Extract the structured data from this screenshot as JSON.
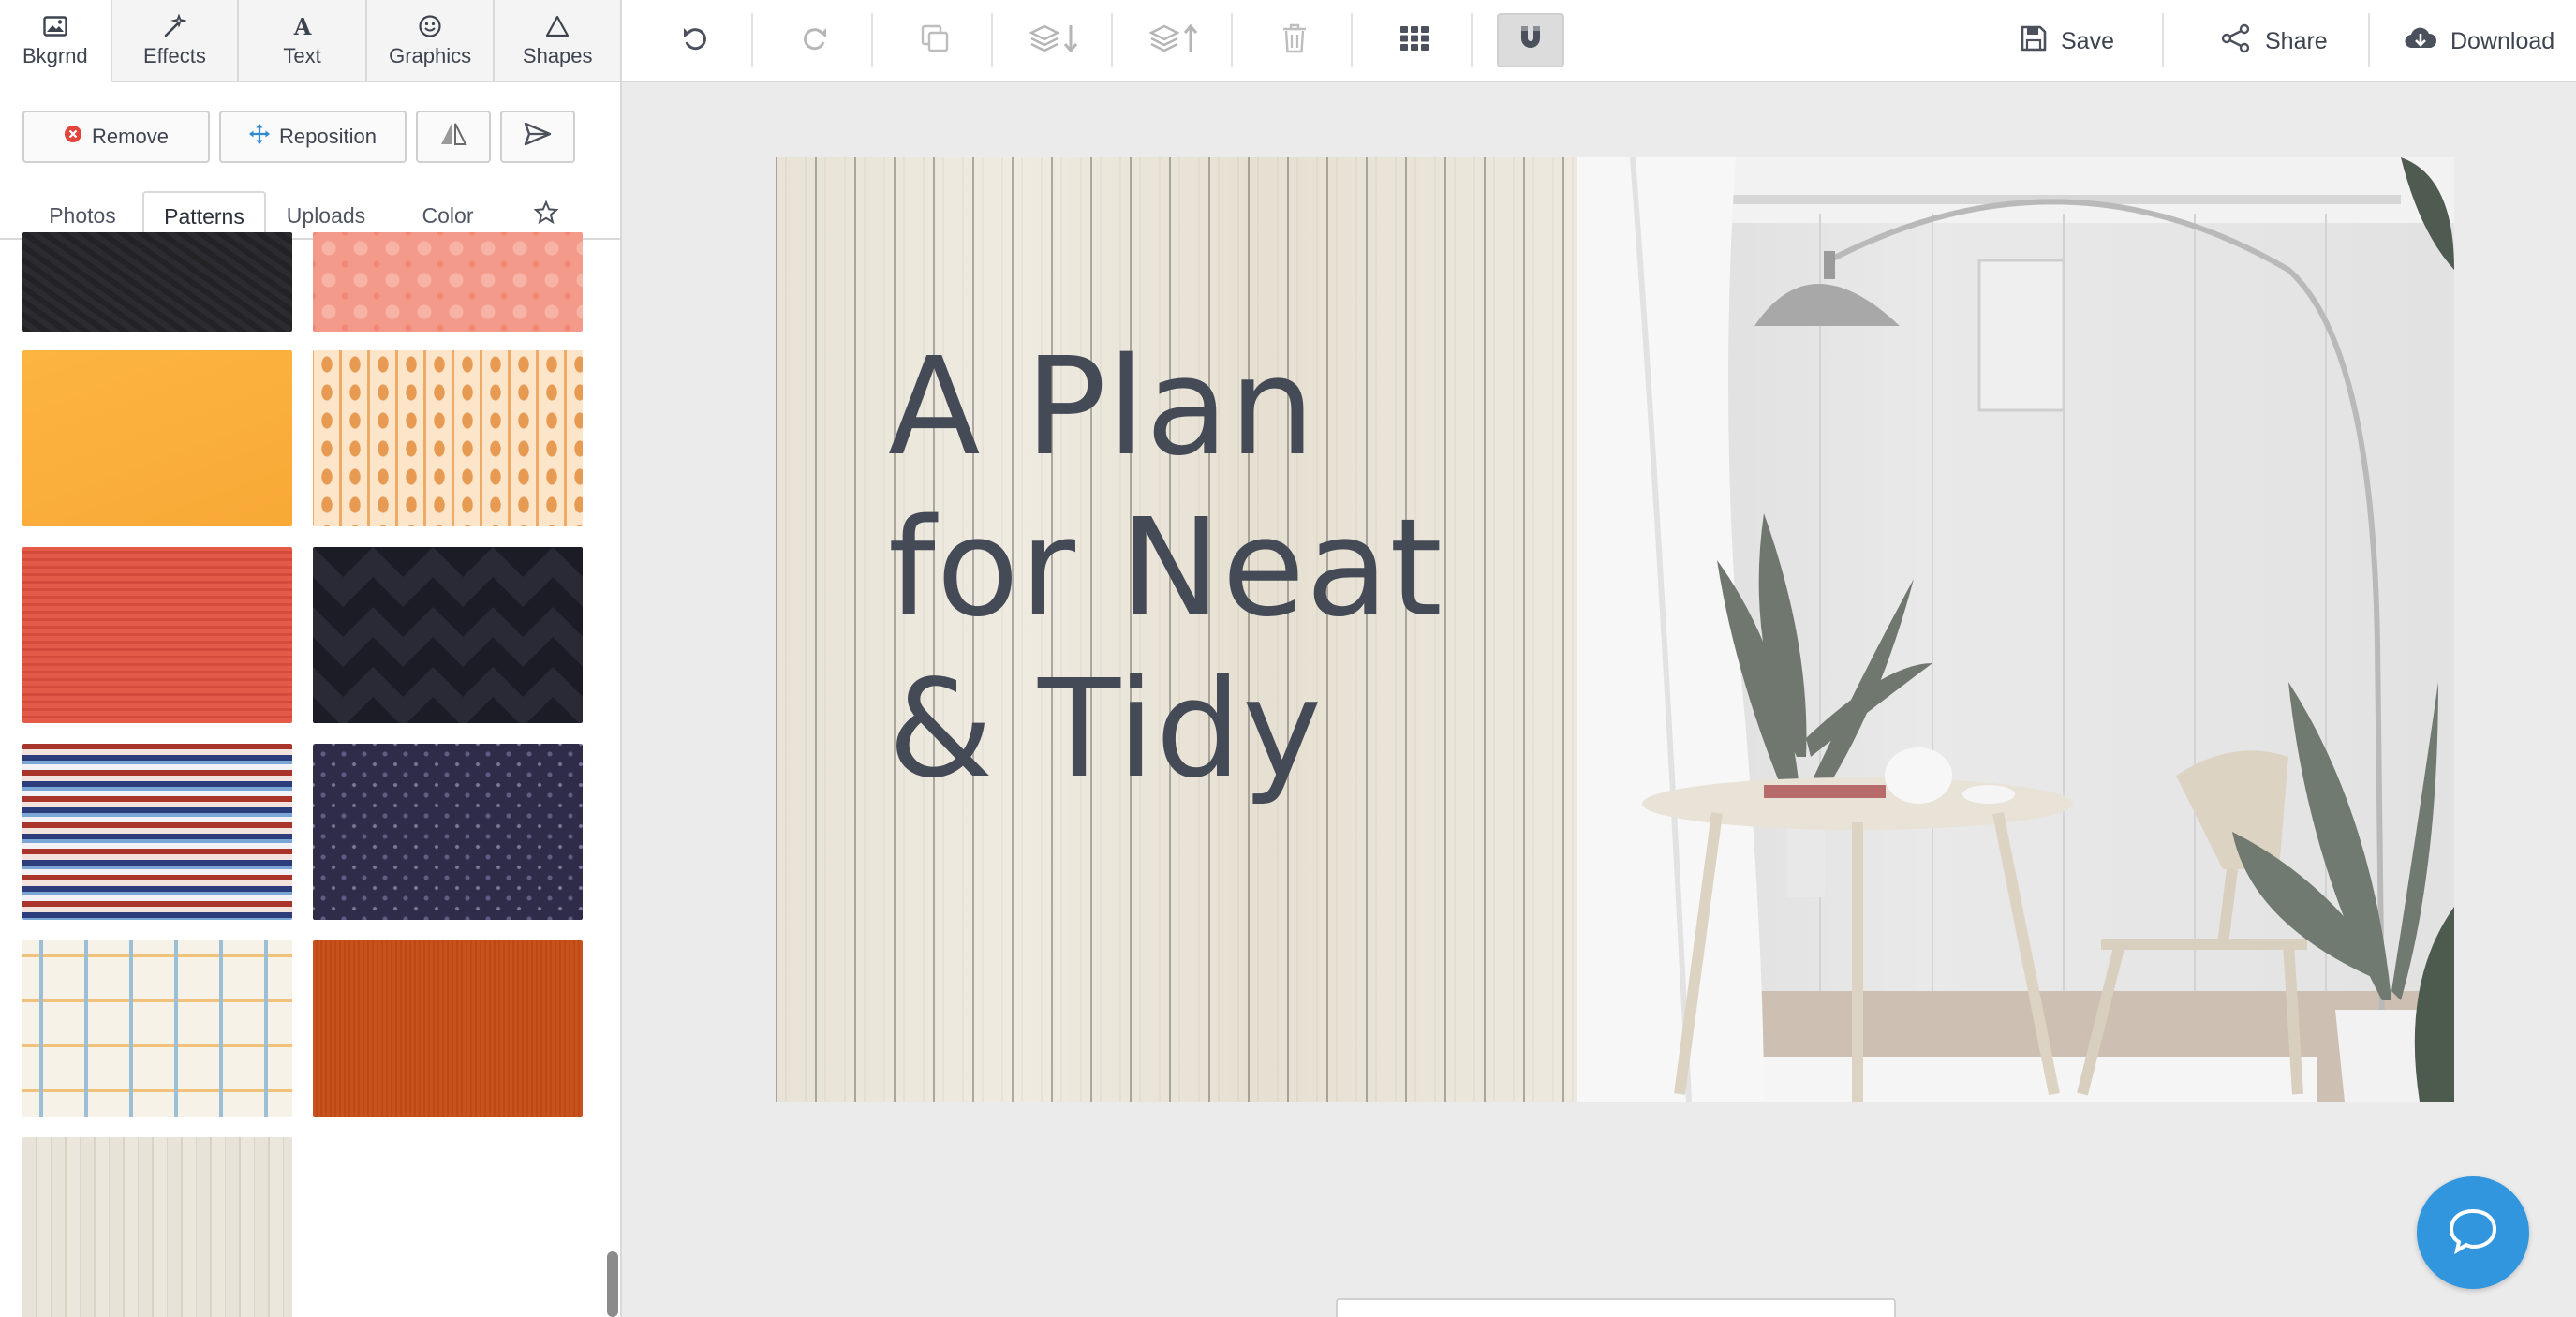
{
  "tool_tabs": [
    {
      "label": "Bkgrnd",
      "icon": "image-icon"
    },
    {
      "label": "Effects",
      "icon": "magic-wand-icon"
    },
    {
      "label": "Text",
      "icon": "text-icon"
    },
    {
      "label": "Graphics",
      "icon": "smiley-icon"
    },
    {
      "label": "Shapes",
      "icon": "triangle-icon"
    }
  ],
  "toolbar": {
    "icons": [
      "undo-icon",
      "redo-icon",
      "duplicate-icon",
      "send-backward-icon",
      "bring-forward-icon",
      "trash-icon",
      "grid-icon",
      "magnet-icon"
    ],
    "save_label": "Save",
    "share_label": "Share",
    "download_label": "Download"
  },
  "panel": {
    "remove_label": "Remove",
    "reposition_label": "Reposition",
    "subtabs": {
      "photos": "Photos",
      "patterns": "Patterns",
      "uploads": "Uploads",
      "color": "Color"
    },
    "active_subtab": "Patterns"
  },
  "patterns": [
    {
      "name": "dark-texture",
      "colors": [
        "#1f1f22",
        "#2b2b2e"
      ]
    },
    {
      "name": "coral-floral",
      "colors": [
        "#f4988a",
        "#f8b4a6"
      ]
    },
    {
      "name": "orange-solid",
      "colors": [
        "#fbb03f",
        "#f9a93a"
      ]
    },
    {
      "name": "kitchen-utensils",
      "colors": [
        "#fde3c6",
        "#e8a05a"
      ]
    },
    {
      "name": "red-texture",
      "colors": [
        "#e65a4a",
        "#d6483b"
      ]
    },
    {
      "name": "dark-chevron",
      "colors": [
        "#1d1d27",
        "#2c2c38"
      ]
    },
    {
      "name": "wave-stripes",
      "colors": [
        "#b23a2e",
        "#2c3c7a",
        "#e8e8f0"
      ]
    },
    {
      "name": "navy-confetti",
      "colors": [
        "#2d2b46",
        "#4a4868"
      ]
    },
    {
      "name": "pastel-geometric",
      "colors": [
        "#f5f1e6",
        "#8fb6cf",
        "#f2c37a"
      ]
    },
    {
      "name": "burnt-orange-linen",
      "colors": [
        "#c9511b",
        "#b4461a"
      ]
    },
    {
      "name": "whitewash-wood",
      "colors": [
        "#e9e5da",
        "#d8d2c4"
      ]
    }
  ],
  "canvas": {
    "headline": [
      "A Plan",
      "for Neat",
      "& Tidy"
    ]
  }
}
